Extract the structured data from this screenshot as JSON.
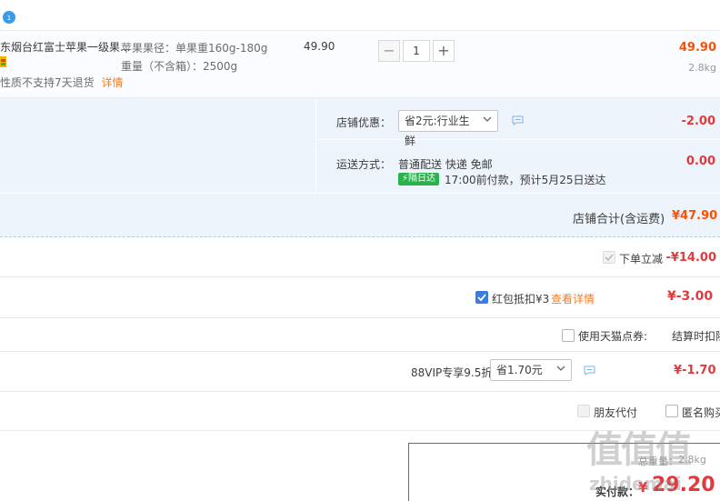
{
  "item": {
    "title": "东烟台红富士苹果一级果...",
    "spec_line1": "苹果果径：单果重160g-180g",
    "spec_line2": "重量（不含箱）：2500g",
    "service_note": "性质不支持7天退货",
    "detail_link": "详情",
    "unit_price": "49.90",
    "quantity": "1",
    "minus_label": "−",
    "plus_label": "+",
    "subtotal": "49.90",
    "weight": "2.8kg"
  },
  "shop": {
    "discount_label": "店铺优惠：",
    "discount_option": "省2元:行业生鲜",
    "discount_amount": "-2.00",
    "shipping_label": "运送方式：",
    "shipping_method": "普通配送 快递 免邮",
    "shipping_tag": "隔日达",
    "shipping_eta": "17:00前付款，预计5月25日送达",
    "shipping_amount": "0.00",
    "total_label": "店铺合计(含运费)",
    "total_amount": "¥47.90"
  },
  "discounts": {
    "instant_label": "下单立减",
    "instant_amount": "-¥14.00",
    "redpacket_label": "红包抵扣¥3",
    "redpacket_link": "查看详情",
    "redpacket_amount": "¥-3.00",
    "tmall_points_label": "使用天猫点券:",
    "tmall_points_note": "结算时扣除",
    "vip_label": "88VIP专享9.5折",
    "vip_option": "省1.70元",
    "vip_amount": "¥-1.70",
    "friend_pay_label": "朋友代付",
    "anonymous_label": "匿名购买"
  },
  "summary": {
    "weight_label": "总重量：",
    "weight_value": "2.8kg",
    "paid_label": "实付款：",
    "paid_currency": "¥",
    "paid_amount": "29.20"
  },
  "watermark": {
    "logo_text": "值值值",
    "site_text": "zhidemai"
  },
  "colors": {
    "accent_red": "#e4393c",
    "accent_orange": "#ff5000",
    "band_blue": "#eef4fb",
    "link_blue": "#3b7ddd"
  }
}
